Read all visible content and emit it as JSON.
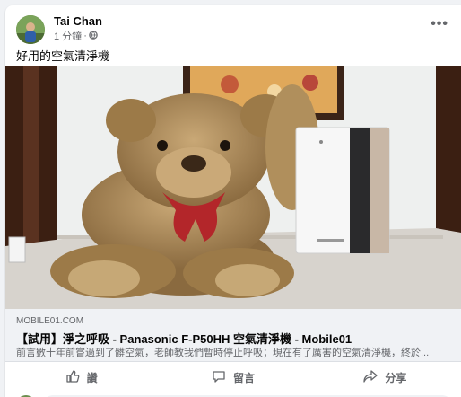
{
  "post": {
    "author": "Tai Chan",
    "time": "1 分鐘",
    "separator": "·",
    "caption": "好用的空氣清淨機",
    "more_label": "•••"
  },
  "link": {
    "domain": "MOBILE01.COM",
    "title": "【試用】淨之呼吸 - Panasonic F-P50HH 空氣清淨機 - Mobile01",
    "description": "前言數十年前嘗過到了髒空氣，老師教我們暫時停止呼吸；現在有了厲害的空氣清淨機，終於..."
  },
  "actions": {
    "like": "讚",
    "comment": "留言",
    "share": "分享"
  },
  "colors": {
    "text_primary": "#050505",
    "text_secondary": "#65676b",
    "card_bg": "#ffffff",
    "page_bg": "#f0f2f5"
  }
}
